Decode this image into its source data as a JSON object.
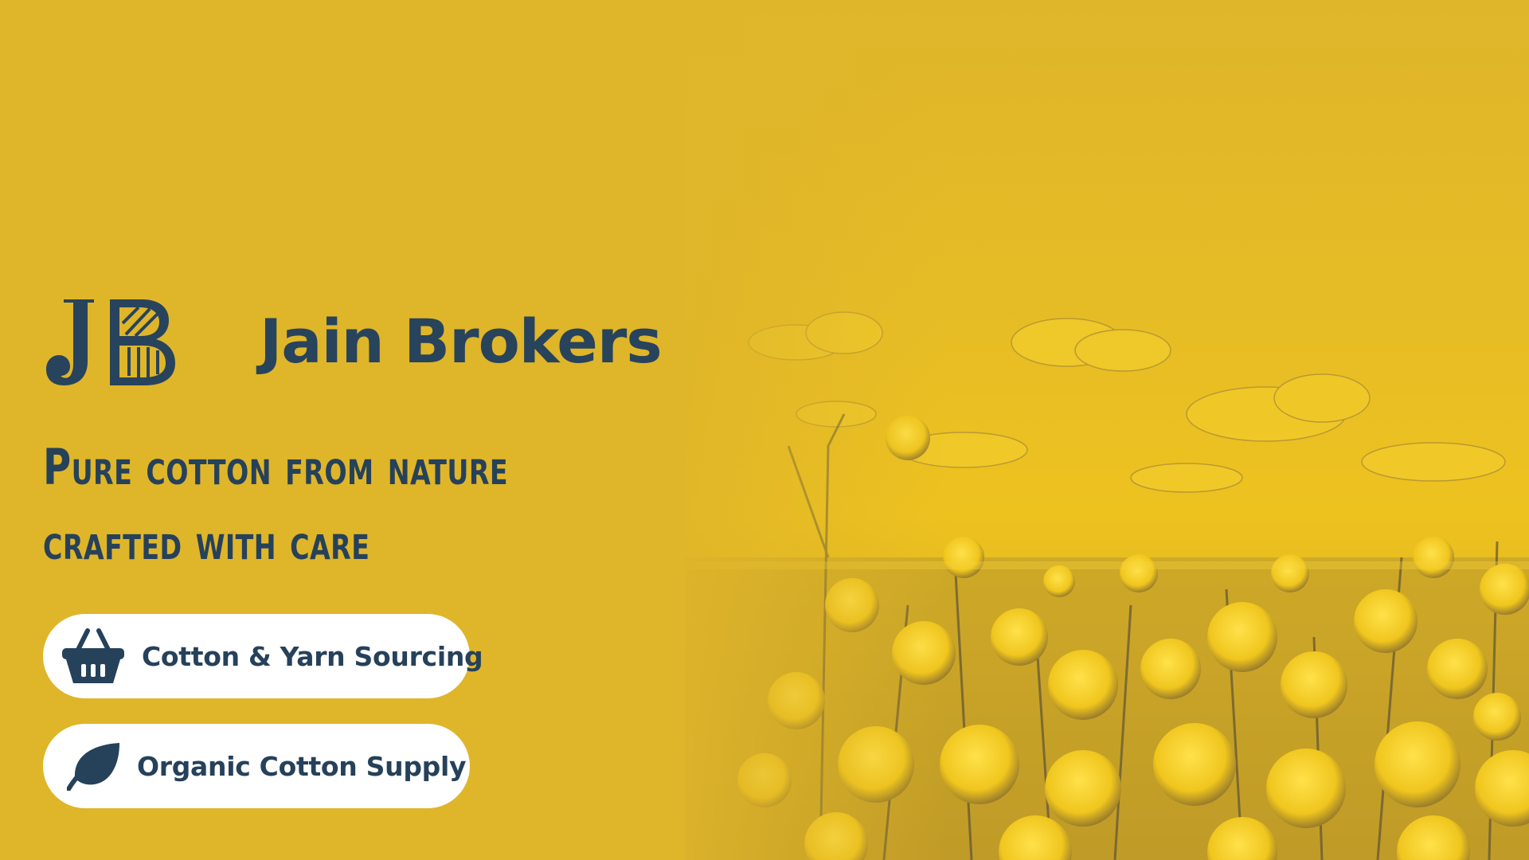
{
  "brand": {
    "name": "Jain Brokers",
    "logo_initials": "JB"
  },
  "tagline": {
    "line1": "Pure cotton from nature",
    "line2": "crafted with care"
  },
  "services": [
    {
      "label": "Cotton & Yarn Sourcing",
      "icon": "basket-icon"
    },
    {
      "label": "Organic Cotton Supply",
      "icon": "leaf-icon"
    }
  ],
  "colors": {
    "background": "#DFB52A",
    "field_tint": "#F2C518",
    "navy": "#26415A",
    "pill": "#FFFFFF"
  }
}
